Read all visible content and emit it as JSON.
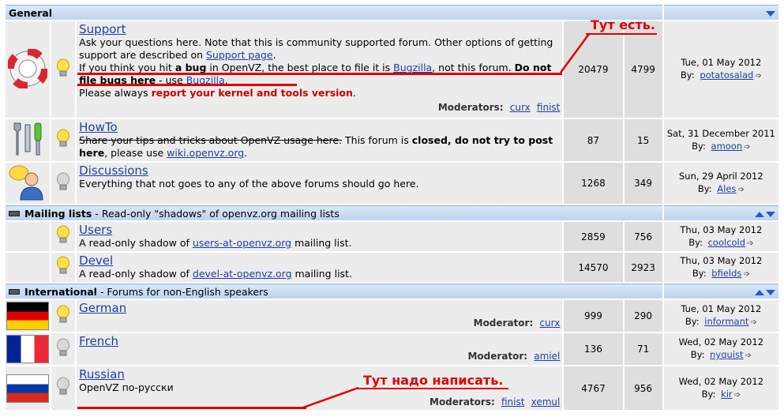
{
  "categories": [
    {
      "name": "General",
      "desc": ""
    },
    {
      "name": "Mailing lists",
      "desc": " - Read-only \"shadows\" of openvz.org mailing lists"
    },
    {
      "name": "International",
      "desc": " - Forums for non-English speakers"
    }
  ],
  "support": {
    "title": "Support",
    "d1": "Ask your questions here. Note that this is community supported forum. Other options of getting support are described on ",
    "link1": "Support page",
    "d2": ".",
    "d3": "If you think you hit ",
    "bold1": "a bug",
    "d4": " in OpenVZ, the best place to file it is ",
    "link2": "Bugzilla",
    "d5": ", not this forum. ",
    "bold2": "Do not file bugs here",
    "d6": " - use ",
    "link3": "Bugzilla",
    "d7": ".",
    "d8": "Please always ",
    "red1": "report your kernel and tools version",
    "d9": ".",
    "mods_label": "Moderators:",
    "mod1": "curx",
    "mod2": "finist",
    "topics": "20479",
    "posts": "4799",
    "date": "Tue, 01 May 2012",
    "by": "By:",
    "user": "potatosalad"
  },
  "howto": {
    "title": "HowTo",
    "strike": "Share your tips and tricks about OpenVZ usage here.",
    "d1": " This forum is ",
    "bold1": "closed, do not try to post here",
    "d2": ", please use ",
    "link1": "wiki.openvz.org",
    "d3": ".",
    "topics": "87",
    "posts": "15",
    "date": "Sat, 31 December 2011",
    "by": "By:",
    "user": "amoon"
  },
  "discussions": {
    "title": "Discussions",
    "desc": "Everything that not goes to any of the above forums should go here.",
    "topics": "1268",
    "posts": "349",
    "date": "Sun, 29 April 2012",
    "by": "By:",
    "user": "Ales"
  },
  "users": {
    "title": "Users",
    "d1": "A read-only shadow of ",
    "link1": "users-at-openvz.org",
    "d2": " mailing list.",
    "topics": "2859",
    "posts": "756",
    "date": "Thu, 03 May 2012",
    "by": "By:",
    "user": "coolcold"
  },
  "devel": {
    "title": "Devel",
    "d1": "A read-only shadow of ",
    "link1": "devel-at-openvz.org",
    "d2": " mailing list.",
    "topics": "14570",
    "posts": "2923",
    "date": "Thu, 03 May 2012",
    "by": "By:",
    "user": "bfields"
  },
  "german": {
    "title": "German",
    "mods_label": "Moderator:",
    "mod1": "curx",
    "topics": "999",
    "posts": "290",
    "date": "Tue, 01 May 2012",
    "by": "By:",
    "user": "informant"
  },
  "french": {
    "title": "French",
    "mods_label": "Moderator:",
    "mod1": "amiel",
    "topics": "136",
    "posts": "71",
    "date": "Wed, 02 May 2012",
    "by": "By:",
    "user": "nyquist"
  },
  "russian": {
    "title": "Russian",
    "desc": "OpenVZ по-русски",
    "mods_label": "Moderators:",
    "mod1": "finist",
    "mod2": "xemul",
    "topics": "4767",
    "posts": "956",
    "date": "Wed, 02 May 2012",
    "by": "By:",
    "user": "kir"
  },
  "annotations": {
    "top": "Тут есть.",
    "bottom": "Тут надо написать."
  },
  "colors": {
    "link": "#1d3fa8",
    "annotation": "#e00000",
    "category": "#bcd4ee"
  }
}
